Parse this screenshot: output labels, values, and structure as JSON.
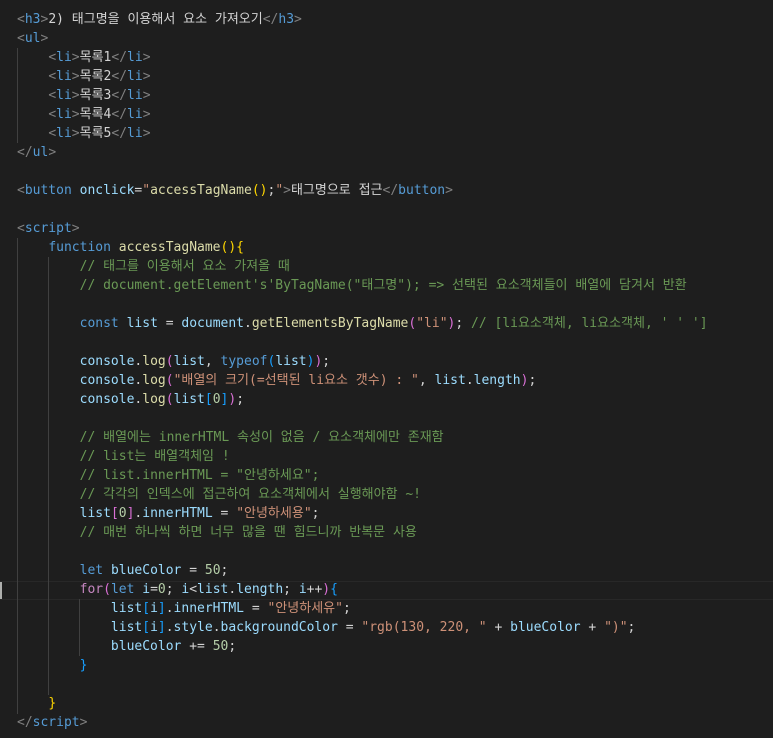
{
  "editor": {
    "colors": {
      "background": "#1e1e1e",
      "tag": "#569cd6",
      "bracket": "#808080",
      "attribute": "#9cdcfe",
      "string": "#ce9178",
      "function": "#dcdcaa",
      "keyword": "#569cd6",
      "control": "#c586c0",
      "comment": "#6a9955",
      "number": "#b5cea8",
      "text": "#d4d4d4",
      "brace_yellow": "#ffd700",
      "brace_pink": "#da70d6",
      "brace_blue": "#179fff"
    },
    "lines": [
      [
        [
          "b",
          "<"
        ],
        [
          "t",
          "h3"
        ],
        [
          "b",
          ">"
        ],
        [
          "x",
          "2) 태그명을 이용해서 요소 가져오기"
        ],
        [
          "b",
          "</"
        ],
        [
          "t",
          "h3"
        ],
        [
          "b",
          ">"
        ]
      ],
      [
        [
          "b",
          "<"
        ],
        [
          "t",
          "ul"
        ],
        [
          "b",
          ">"
        ]
      ],
      [
        [
          "x",
          "    "
        ],
        [
          "b",
          "<"
        ],
        [
          "t",
          "li"
        ],
        [
          "b",
          ">"
        ],
        [
          "x",
          "목록1"
        ],
        [
          "b",
          "</"
        ],
        [
          "t",
          "li"
        ],
        [
          "b",
          ">"
        ]
      ],
      [
        [
          "x",
          "    "
        ],
        [
          "b",
          "<"
        ],
        [
          "t",
          "li"
        ],
        [
          "b",
          ">"
        ],
        [
          "x",
          "목록2"
        ],
        [
          "b",
          "</"
        ],
        [
          "t",
          "li"
        ],
        [
          "b",
          ">"
        ]
      ],
      [
        [
          "x",
          "    "
        ],
        [
          "b",
          "<"
        ],
        [
          "t",
          "li"
        ],
        [
          "b",
          ">"
        ],
        [
          "x",
          "목록3"
        ],
        [
          "b",
          "</"
        ],
        [
          "t",
          "li"
        ],
        [
          "b",
          ">"
        ]
      ],
      [
        [
          "x",
          "    "
        ],
        [
          "b",
          "<"
        ],
        [
          "t",
          "li"
        ],
        [
          "b",
          ">"
        ],
        [
          "x",
          "목록4"
        ],
        [
          "b",
          "</"
        ],
        [
          "t",
          "li"
        ],
        [
          "b",
          ">"
        ]
      ],
      [
        [
          "x",
          "    "
        ],
        [
          "b",
          "<"
        ],
        [
          "t",
          "li"
        ],
        [
          "b",
          ">"
        ],
        [
          "x",
          "목록5"
        ],
        [
          "b",
          "</"
        ],
        [
          "t",
          "li"
        ],
        [
          "b",
          ">"
        ]
      ],
      [
        [
          "b",
          "</"
        ],
        [
          "t",
          "ul"
        ],
        [
          "b",
          ">"
        ]
      ],
      [],
      [
        [
          "b",
          "<"
        ],
        [
          "t",
          "button"
        ],
        [
          "x",
          " "
        ],
        [
          "a",
          "onclick"
        ],
        [
          "x",
          "="
        ],
        [
          "s",
          "\""
        ],
        [
          "f",
          "accessTagName"
        ],
        [
          "y",
          "()"
        ],
        [
          "x",
          ";"
        ],
        [
          "s",
          "\""
        ],
        [
          "b",
          ">"
        ],
        [
          "x",
          "태그명으로 접근"
        ],
        [
          "b",
          "</"
        ],
        [
          "t",
          "button"
        ],
        [
          "b",
          ">"
        ]
      ],
      [],
      [
        [
          "b",
          "<"
        ],
        [
          "t",
          "script"
        ],
        [
          "b",
          ">"
        ]
      ],
      [
        [
          "x",
          "    "
        ],
        [
          "k",
          "function"
        ],
        [
          "x",
          " "
        ],
        [
          "f",
          "accessTagName"
        ],
        [
          "y",
          "(){"
        ]
      ],
      [
        [
          "x",
          "        "
        ],
        [
          "c",
          "// 태그를 이용해서 요소 가져올 때"
        ]
      ],
      [
        [
          "x",
          "        "
        ],
        [
          "c",
          "// document.getElement's'ByTagName(\"태그명\"); => 선택된 요소객체들이 배열에 담겨서 반환"
        ]
      ],
      [],
      [
        [
          "x",
          "        "
        ],
        [
          "k",
          "const"
        ],
        [
          "x",
          " "
        ],
        [
          "v",
          "list"
        ],
        [
          "x",
          " = "
        ],
        [
          "v",
          "document"
        ],
        [
          "x",
          "."
        ],
        [
          "f",
          "getElementsByTagName"
        ],
        [
          "p",
          "("
        ],
        [
          "s",
          "\"li\""
        ],
        [
          "p",
          ")"
        ],
        [
          "x",
          "; "
        ],
        [
          "c",
          "// [li요소객체, li요소객체, ' ' ']"
        ]
      ],
      [],
      [
        [
          "x",
          "        "
        ],
        [
          "v",
          "console"
        ],
        [
          "x",
          "."
        ],
        [
          "f",
          "log"
        ],
        [
          "p",
          "("
        ],
        [
          "v",
          "list"
        ],
        [
          "x",
          ", "
        ],
        [
          "k",
          "typeof"
        ],
        [
          "u",
          "("
        ],
        [
          "v",
          "list"
        ],
        [
          "u",
          ")"
        ],
        [
          "p",
          ")"
        ],
        [
          "x",
          ";"
        ]
      ],
      [
        [
          "x",
          "        "
        ],
        [
          "v",
          "console"
        ],
        [
          "x",
          "."
        ],
        [
          "f",
          "log"
        ],
        [
          "p",
          "("
        ],
        [
          "s",
          "\"배열의 크기(=선택된 li요소 갯수) : \""
        ],
        [
          "x",
          ", "
        ],
        [
          "v",
          "list"
        ],
        [
          "x",
          "."
        ],
        [
          "v",
          "length"
        ],
        [
          "p",
          ")"
        ],
        [
          "x",
          ";"
        ]
      ],
      [
        [
          "x",
          "        "
        ],
        [
          "v",
          "console"
        ],
        [
          "x",
          "."
        ],
        [
          "f",
          "log"
        ],
        [
          "p",
          "("
        ],
        [
          "v",
          "list"
        ],
        [
          "u",
          "["
        ],
        [
          "n",
          "0"
        ],
        [
          "u",
          "]"
        ],
        [
          "p",
          ")"
        ],
        [
          "x",
          ";"
        ]
      ],
      [],
      [
        [
          "x",
          "        "
        ],
        [
          "c",
          "// 배열에는 innerHTML 속성이 없음 / 요소객체에만 존재함"
        ]
      ],
      [
        [
          "x",
          "        "
        ],
        [
          "c",
          "// list는 배열객체임 !"
        ]
      ],
      [
        [
          "x",
          "        "
        ],
        [
          "c",
          "// list.innerHTML = \"안녕하세요\";"
        ]
      ],
      [
        [
          "x",
          "        "
        ],
        [
          "c",
          "// 각각의 인덱스에 접근하여 요소객체에서 실행해야함 ~!"
        ]
      ],
      [
        [
          "x",
          "        "
        ],
        [
          "v",
          "list"
        ],
        [
          "p",
          "["
        ],
        [
          "n",
          "0"
        ],
        [
          "p",
          "]"
        ],
        [
          "x",
          "."
        ],
        [
          "v",
          "innerHTML"
        ],
        [
          "x",
          " = "
        ],
        [
          "s",
          "\"안녕하세용\""
        ],
        [
          "x",
          ";"
        ]
      ],
      [
        [
          "x",
          "        "
        ],
        [
          "c",
          "// 매번 하나씩 하면 너무 많을 땐 힘드니까 반복문 사용"
        ]
      ],
      [],
      [
        [
          "x",
          "        "
        ],
        [
          "k",
          "let"
        ],
        [
          "x",
          " "
        ],
        [
          "v",
          "blueColor"
        ],
        [
          "x",
          " = "
        ],
        [
          "n",
          "50"
        ],
        [
          "x",
          ";"
        ]
      ],
      [
        [
          "x",
          "        "
        ],
        [
          "r",
          "for"
        ],
        [
          "p",
          "("
        ],
        [
          "k",
          "let"
        ],
        [
          "x",
          " "
        ],
        [
          "v",
          "i"
        ],
        [
          "x",
          "="
        ],
        [
          "n",
          "0"
        ],
        [
          "x",
          "; "
        ],
        [
          "v",
          "i"
        ],
        [
          "x",
          "<"
        ],
        [
          "v",
          "list"
        ],
        [
          "x",
          "."
        ],
        [
          "v",
          "length"
        ],
        [
          "x",
          "; "
        ],
        [
          "v",
          "i"
        ],
        [
          "x",
          "++"
        ],
        [
          "p",
          ")"
        ],
        [
          "u",
          "{"
        ]
      ],
      [
        [
          "x",
          "            "
        ],
        [
          "v",
          "list"
        ],
        [
          "u",
          "["
        ],
        [
          "v",
          "i"
        ],
        [
          "u",
          "]"
        ],
        [
          "x",
          "."
        ],
        [
          "v",
          "innerHTML"
        ],
        [
          "x",
          " = "
        ],
        [
          "s",
          "\"안녕하세유\""
        ],
        [
          "x",
          ";"
        ]
      ],
      [
        [
          "x",
          "            "
        ],
        [
          "v",
          "list"
        ],
        [
          "u",
          "["
        ],
        [
          "v",
          "i"
        ],
        [
          "u",
          "]"
        ],
        [
          "x",
          "."
        ],
        [
          "v",
          "style"
        ],
        [
          "x",
          "."
        ],
        [
          "v",
          "backgroundColor"
        ],
        [
          "x",
          " = "
        ],
        [
          "s",
          "\"rgb(130, 220, \""
        ],
        [
          "x",
          " + "
        ],
        [
          "v",
          "blueColor"
        ],
        [
          "x",
          " + "
        ],
        [
          "s",
          "\")\""
        ],
        [
          "x",
          ";"
        ]
      ],
      [
        [
          "x",
          "            "
        ],
        [
          "v",
          "blueColor"
        ],
        [
          "x",
          " += "
        ],
        [
          "n",
          "50"
        ],
        [
          "x",
          ";"
        ]
      ],
      [
        [
          "x",
          "        "
        ],
        [
          "u",
          "}"
        ]
      ],
      [],
      [
        [
          "x",
          "    "
        ],
        [
          "y",
          "}"
        ]
      ],
      [
        [
          "b",
          "</"
        ],
        [
          "t",
          "script"
        ],
        [
          "b",
          ">"
        ]
      ]
    ]
  }
}
